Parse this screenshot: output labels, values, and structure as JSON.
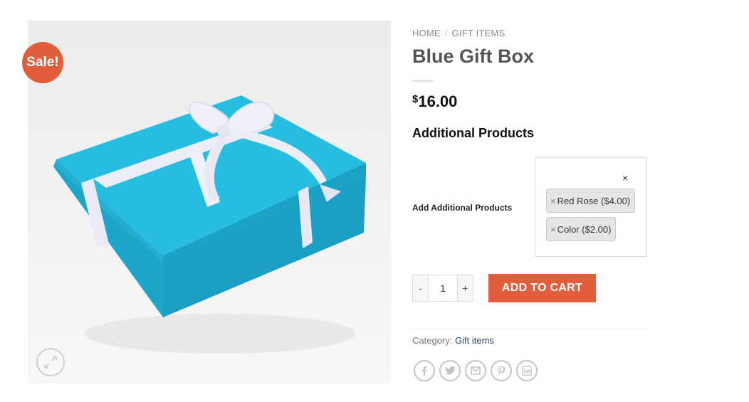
{
  "product": {
    "sale_badge": "Sale!",
    "title": "Blue Gift Box",
    "price_symbol": "$",
    "price_amount": "16.00",
    "image_icon": "gift-box-image",
    "zoom_icon": "expand-icon"
  },
  "breadcrumb": {
    "home": "HOME",
    "separator": "/",
    "category": "GIFT ITEMS"
  },
  "additional_products": {
    "heading": "Additional Products",
    "field_label": "Add Additional Products",
    "clear_all": "×",
    "selected": [
      {
        "remove": "×",
        "label": "Red Rose ($4.00)"
      },
      {
        "remove": "×",
        "label": "Color ($2.00)"
      }
    ]
  },
  "cart": {
    "minus": "-",
    "quantity": "1",
    "plus": "+",
    "add_to_cart": "ADD TO CART"
  },
  "meta": {
    "category_label": "Category:",
    "category_value": "Gift items"
  },
  "share": [
    {
      "icon": "facebook-icon"
    },
    {
      "icon": "twitter-icon"
    },
    {
      "icon": "email-icon"
    },
    {
      "icon": "pinterest-icon"
    },
    {
      "icon": "linkedin-icon"
    }
  ],
  "colors": {
    "accent": "#e05e3b",
    "box_blue": "#21b4d8",
    "link": "#334862"
  }
}
